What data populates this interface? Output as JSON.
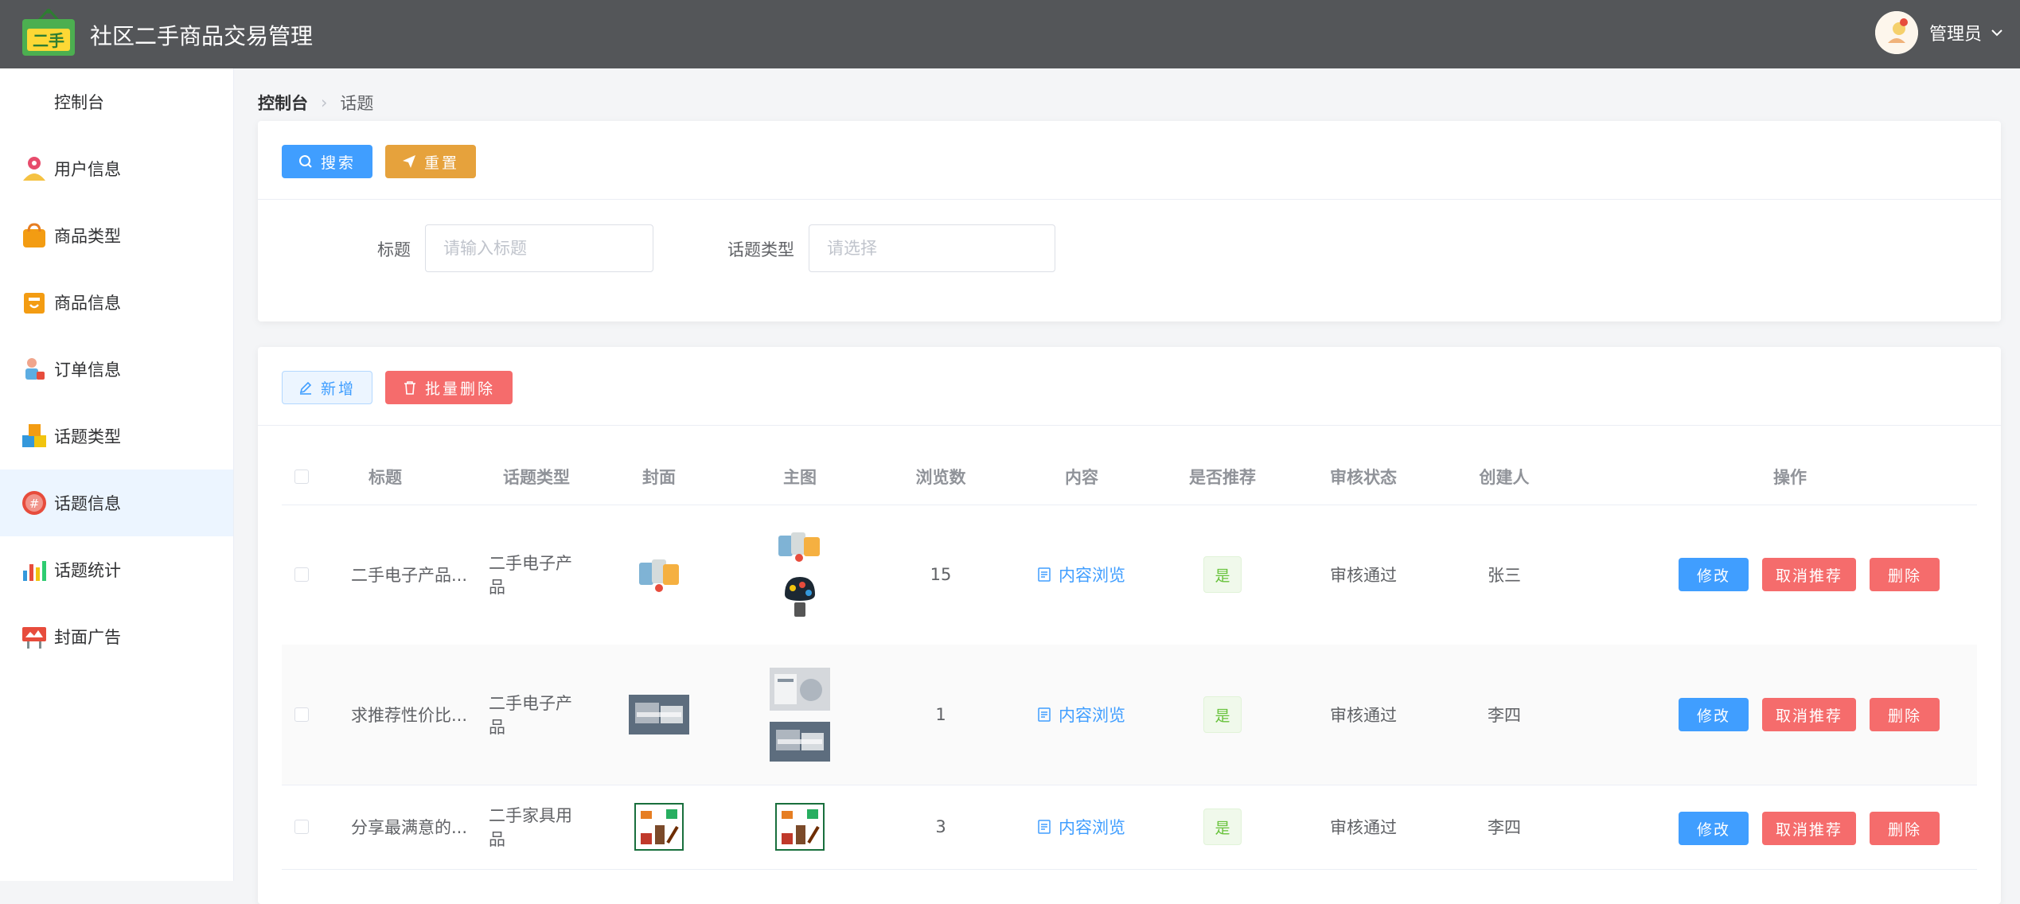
{
  "header": {
    "title": "社区二手商品交易管理",
    "logo_text": "二手",
    "user_name": "管理员"
  },
  "sidebar": {
    "items": [
      {
        "label": "控制台",
        "icon": "dashboard"
      },
      {
        "label": "用户信息",
        "icon": "user-icon"
      },
      {
        "label": "商品类型",
        "icon": "shopping-bag-icon"
      },
      {
        "label": "商品信息",
        "icon": "store-icon"
      },
      {
        "label": "订单信息",
        "icon": "order-icon"
      },
      {
        "label": "话题类型",
        "icon": "cubes-icon"
      },
      {
        "label": "话题信息",
        "icon": "hashtag-icon"
      },
      {
        "label": "话题统计",
        "icon": "bar-chart-icon"
      },
      {
        "label": "封面广告",
        "icon": "billboard-icon"
      }
    ],
    "active_index": 6
  },
  "breadcrumb": {
    "root": "控制台",
    "current": "话题"
  },
  "search": {
    "search_button": "搜索",
    "reset_button": "重置",
    "title_label": "标题",
    "title_placeholder": "请输入标题",
    "type_label": "话题类型",
    "type_placeholder": "请选择"
  },
  "toolbar": {
    "add_button": "新增",
    "batch_delete_button": "批量删除"
  },
  "table": {
    "columns": [
      "标题",
      "话题类型",
      "封面",
      "主图",
      "浏览数",
      "内容",
      "是否推荐",
      "审核状态",
      "创建人",
      "操作"
    ],
    "rows": [
      {
        "title": "二手电子产品...",
        "type": "二手电子产品",
        "views": "15",
        "content_link": "内容浏览",
        "recommended": "是",
        "status": "审核通过",
        "creator": "张三"
      },
      {
        "title": "求推荐性价比...",
        "type": "二手电子产品",
        "views": "1",
        "content_link": "内容浏览",
        "recommended": "是",
        "status": "审核通过",
        "creator": "李四"
      },
      {
        "title": "分享最满意的...",
        "type": "二手家具用品",
        "views": "3",
        "content_link": "内容浏览",
        "recommended": "是",
        "status": "审核通过",
        "creator": "李四"
      }
    ],
    "actions": {
      "edit": "修改",
      "cancel_recommend": "取消推荐",
      "delete": "删除"
    }
  },
  "colors": {
    "header_bg": "#545659",
    "primary": "#409eff",
    "warning": "#e6a23c",
    "danger": "#f56c6c",
    "success": "#67c23a"
  }
}
